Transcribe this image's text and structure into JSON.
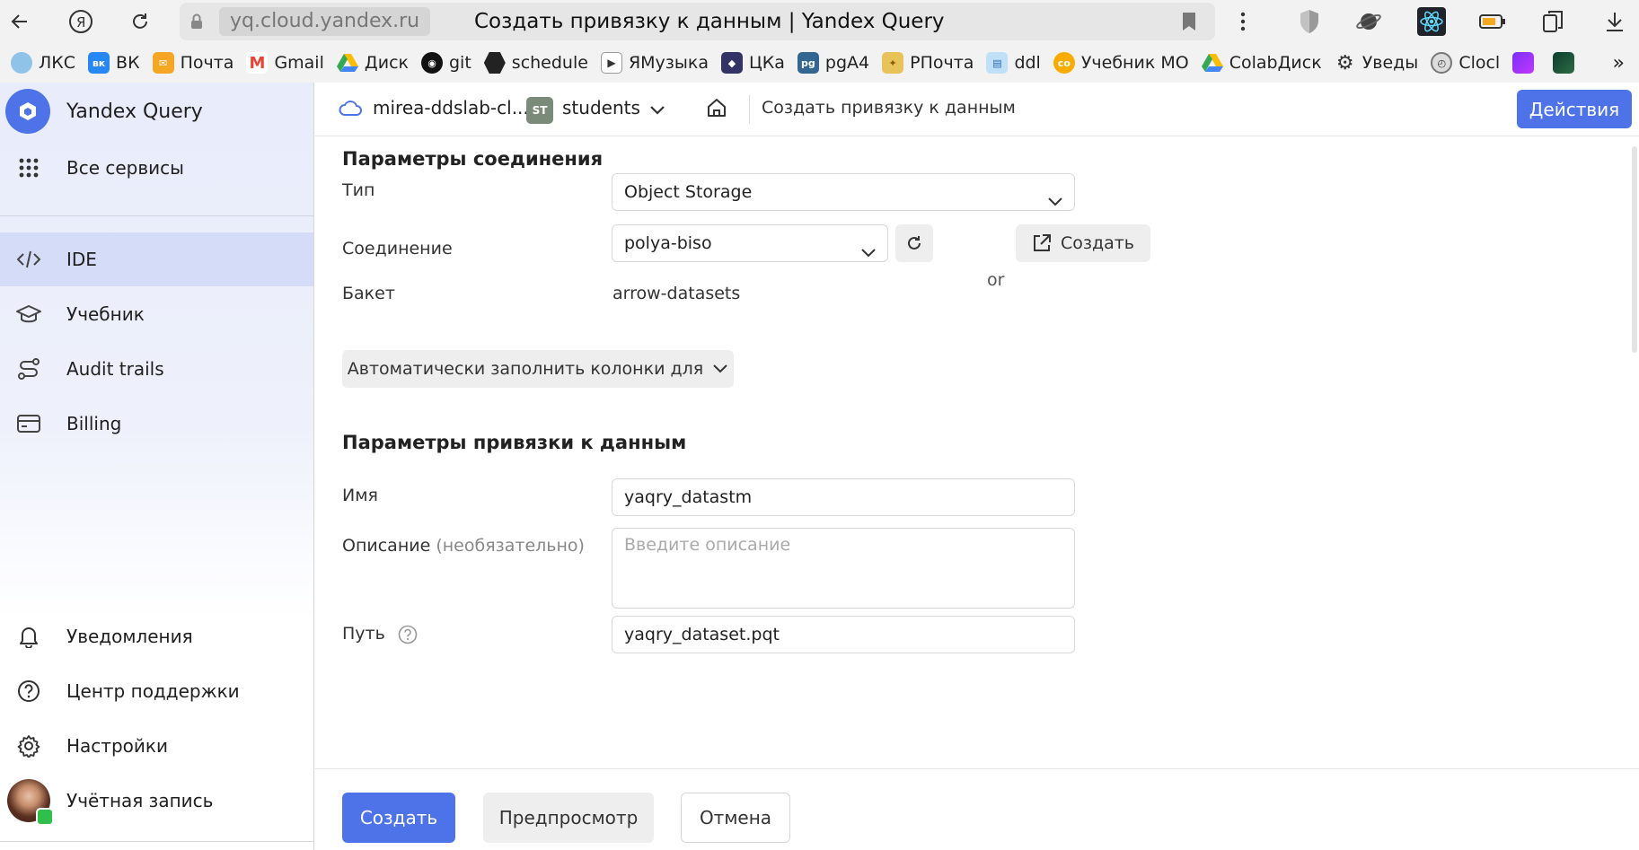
{
  "browser": {
    "url_host": "yq.cloud.yandex.ru",
    "tab_title": "Создать привязку к данным | Yandex Query"
  },
  "bookmarks": [
    {
      "label": "ЛКС",
      "icon": "globe-icon",
      "color": "#5aa0d8"
    },
    {
      "label": "ВК",
      "icon": "vk-icon",
      "color": "#2787f5"
    },
    {
      "label": "Почта",
      "icon": "mail-icon",
      "color": "#f5a623"
    },
    {
      "label": "Gmail",
      "icon": "gmail-icon",
      "color": "#ea4335"
    },
    {
      "label": "Диск",
      "icon": "drive-icon",
      "color": "#34a853"
    },
    {
      "label": "git",
      "icon": "github-icon",
      "color": "#111111"
    },
    {
      "label": "schedule",
      "icon": "hexagon-icon",
      "color": "#222222"
    },
    {
      "label": "ЯМузыка",
      "icon": "play-icon",
      "color": "#555555"
    },
    {
      "label": "ЦКа",
      "icon": "shield-icon",
      "color": "#333366"
    },
    {
      "label": "pgA4",
      "icon": "pg-icon",
      "color": "#336791"
    },
    {
      "label": "РПочта",
      "icon": "emblem-icon",
      "color": "#d4a017"
    },
    {
      "label": "ddl",
      "icon": "book-icon",
      "color": "#4a90d9"
    },
    {
      "label": "Учебник МО",
      "icon": "colab-icon",
      "color": "#f9ab00"
    },
    {
      "label": "ColabДиск",
      "icon": "drive-icon",
      "color": "#34a853"
    },
    {
      "label": "Уведы",
      "icon": "gear-icon",
      "color": "#333333"
    },
    {
      "label": "Clocl",
      "icon": "clock-icon",
      "color": "#777777"
    }
  ],
  "sidebar": {
    "brand": "Yandex Query",
    "all_services": "Все сервисы",
    "items": [
      {
        "label": "IDE"
      },
      {
        "label": "Учебник"
      },
      {
        "label": "Audit trails"
      },
      {
        "label": "Billing"
      }
    ],
    "bottom": [
      {
        "label": "Уведомления"
      },
      {
        "label": "Центр поддержки"
      },
      {
        "label": "Настройки"
      },
      {
        "label": "Учётная запись"
      }
    ]
  },
  "header": {
    "cloud_name": "mirea-ddslab-cl...",
    "folder_badge": "ST",
    "folder_name": "students",
    "page_title": "Создать привязку к данным",
    "actions_label": "Действия"
  },
  "form": {
    "connection_section": "Параметры соединения",
    "type_label": "Тип",
    "type_value": "Object Storage",
    "connection_label": "Соединение",
    "connection_value": "polya-biso",
    "or_text": "or",
    "create_connection_label": "Создать",
    "bucket_label": "Бакет",
    "bucket_value": "arrow-datasets",
    "autofill_label": "Автоматически заполнить колонки для",
    "binding_section": "Параметры привязки к данным",
    "name_label": "Имя",
    "name_value": "yaqry_datastm",
    "description_label": "Описание",
    "description_optional": "(необязательно)",
    "description_placeholder": "Введите описание",
    "path_label": "Путь",
    "path_value": "yaqry_dataset.pqt"
  },
  "footer": {
    "submit": "Создать",
    "preview": "Предпросмотр",
    "cancel": "Отмена"
  },
  "colors": {
    "accent": "#4e73e8",
    "sidebar_active": "#d4dcf8"
  }
}
